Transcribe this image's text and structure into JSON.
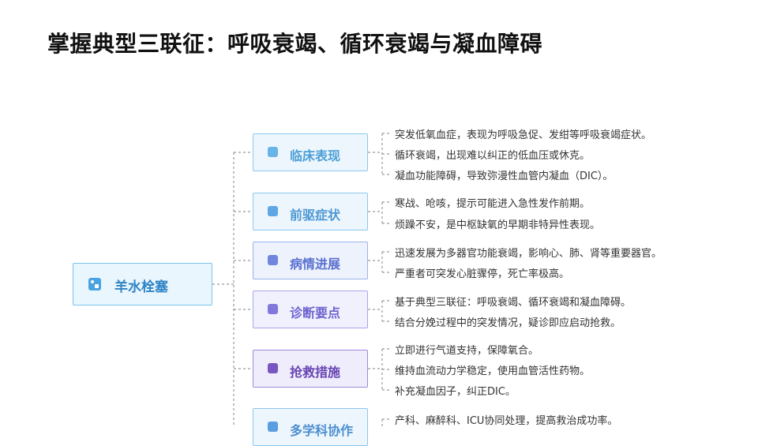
{
  "title": "掌握典型三联征：呼吸衰竭、循环衰竭与凝血障碍",
  "root": {
    "label": "羊水栓塞",
    "icon": "dashboard-icon"
  },
  "branches": [
    {
      "label": "临床表现",
      "icon": "person-icon",
      "items": [
        "突发低氧血症，表现为呼吸急促、发绀等呼吸衰竭症状。",
        "循环衰竭，出现难以纠正的低血压或休克。",
        "凝血功能障碍，导致弥漫性血管内凝血（DIC）。"
      ]
    },
    {
      "label": "前驱症状",
      "icon": "cart-icon",
      "items": [
        "寒战、呛咳，提示可能进入急性发作前期。",
        "烦躁不安，是中枢缺氧的早期非特异性表现。"
      ]
    },
    {
      "label": "病情进展",
      "icon": "car-icon",
      "items": [
        "迅速发展为多器官功能衰竭，影响心、肺、肾等重要器官。",
        "严重者可突发心脏骤停，死亡率极高。"
      ]
    },
    {
      "label": "诊断要点",
      "icon": "database-icon",
      "items": [
        "基于典型三联征：呼吸衰竭、循环衰竭和凝血障碍。",
        "结合分娩过程中的突发情况，疑诊即应启动抢救。"
      ]
    },
    {
      "label": "抢救措施",
      "icon": "yen-icon",
      "items": [
        "立即进行气道支持，保障氧合。",
        "维持血流动力学稳定，使用血管活性药物。",
        "补充凝血因子，纠正DIC。"
      ]
    },
    {
      "label": "多学科协作",
      "icon": "database-icon",
      "items": [
        "产科、麻醉科、ICU协同处理，提高救治成功率。"
      ]
    }
  ]
}
